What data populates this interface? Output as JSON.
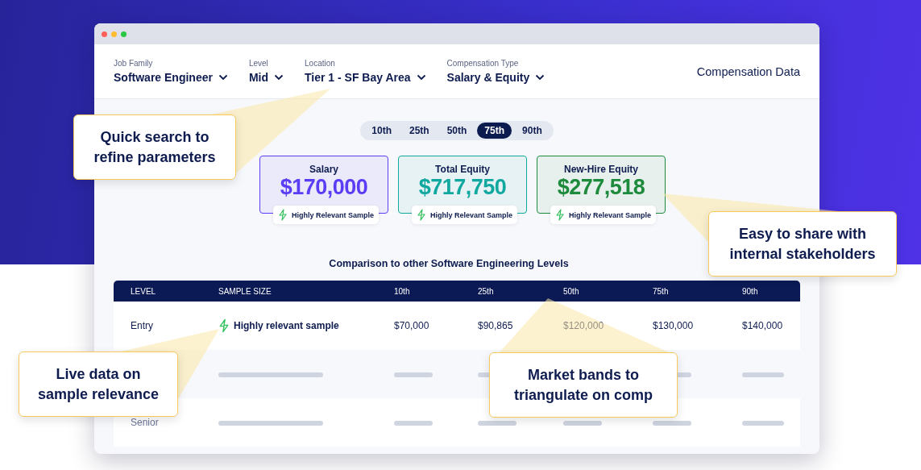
{
  "filters": [
    {
      "label": "Job Family",
      "value": "Software Engineer"
    },
    {
      "label": "Level",
      "value": "Mid"
    },
    {
      "label": "Location",
      "value": "Tier 1 - SF Bay Area"
    },
    {
      "label": "Compensation Type",
      "value": "Salary & Equity"
    }
  ],
  "header_title": "Compensation Data",
  "percentiles": [
    {
      "label": "10th",
      "selected": false
    },
    {
      "label": "25th",
      "selected": false
    },
    {
      "label": "50th",
      "selected": false
    },
    {
      "label": "75th",
      "selected": true
    },
    {
      "label": "90th",
      "selected": false
    }
  ],
  "cards": [
    {
      "label": "Salary",
      "value": "$170,000",
      "color": "#5b3df5",
      "badge": "Highly Relevant Sample"
    },
    {
      "label": "Total Equity",
      "value": "$717,750",
      "color": "#11a8a0",
      "badge": "Highly Relevant Sample"
    },
    {
      "label": "New-Hire Equity",
      "value": "$277,518",
      "color": "#1d8a3c",
      "badge": "Highly Relevant Sample"
    }
  ],
  "table": {
    "title": "Comparison to other Software Engineering Levels",
    "columns": [
      "LEVEL",
      "SAMPLE SIZE",
      "10th",
      "25th",
      "50th",
      "75th",
      "90th"
    ],
    "rows": [
      {
        "kind": "data",
        "level": "Entry",
        "sample": "Highly relevant sample",
        "values": [
          "$70,000",
          "$90,865",
          "$120,000",
          "$130,000",
          "$140,000"
        ]
      },
      {
        "kind": "placeholder"
      },
      {
        "kind": "placeholder",
        "level": "Senior"
      }
    ]
  },
  "callouts": [
    {
      "text": "Quick search to refine parameters"
    },
    {
      "text": "Easy to share with internal stakeholders"
    },
    {
      "text": "Live data on sample relevance"
    },
    {
      "text": "Market bands to triangulate on comp"
    }
  ]
}
